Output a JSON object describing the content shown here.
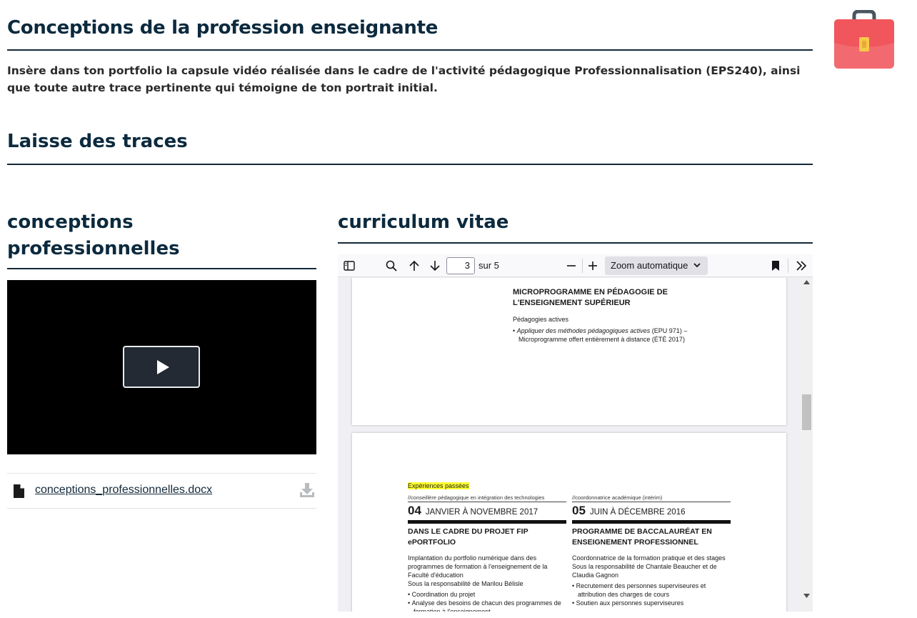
{
  "header": {
    "title": "Conceptions de la profession enseignante",
    "intro": "Insère dans ton portfolio la capsule vidéo réalisée dans le cadre de l'activité pédagogique Professionnalisation (EPS240), ainsi que toute autre trace pertinente qui témoigne de ton portrait initial.",
    "section_title": "Laisse des traces",
    "icon": "briefcase-icon",
    "icon_color": "#f0565c"
  },
  "left_column": {
    "title_line1": "conceptions",
    "title_line2": "professionnelles",
    "video": {
      "state": "paused",
      "play_label": "play"
    },
    "file": {
      "name": "conceptions_professionnelles.docx",
      "icon": "file-icon",
      "action_icon": "download-icon"
    }
  },
  "right_column": {
    "title": "curriculum vitae",
    "viewer": {
      "current_page": "3",
      "total_pages": "sur 5",
      "zoom": "Zoom automatique",
      "page_a": {
        "heading": "MICROPROGRAMME EN PÉDAGOGIE DE L'ENSEIGNEMENT SUPÉRIEUR",
        "sub": "Pédagogies actives",
        "item_italic": "Appliquer des méthodes pédagogiques actives",
        "item_rest": " (EPU 971) –",
        "item_line2": "Microprogramme offert entièrement à distance (ÉTÉ 2017)"
      },
      "page_b": {
        "section": "Expériences passées",
        "entries": [
          {
            "tag": "//conseillère pédagogique en intégration des technologies",
            "num": "04",
            "date": "JANVIER À NOVEMBRE 2017",
            "title": "DANS LE CADRE DU PROJET FIP ePORTFOLIO",
            "desc": "Implantation du portfolio numérique dans des programmes de formation à l'enseignement de la Faculté d'éducation",
            "resp": "Sous la responsabilité de Marilou Bélisle",
            "bullets": [
              "Coordination du projet",
              "Analyse des besoins de chacun des programmes de formation à l'enseignement"
            ]
          },
          {
            "tag": "//coordonnatrice académique (intérim)",
            "num": "05",
            "date": "JUIN À DÉCEMBRE 2016",
            "title": "PROGRAMME DE BACCALAURÉAT EN ENSEIGNEMENT PROFESSIONNEL",
            "desc": "Coordonnatrice de la formation pratique et des stages",
            "resp": "Sous la responsabilité de Chantale Beaucher et de Claudia Gagnon",
            "bullets": [
              "Recrutement des personnes superviseures et attribution des charges de cours",
              "Soutien aux personnes superviseures"
            ]
          }
        ]
      }
    }
  }
}
